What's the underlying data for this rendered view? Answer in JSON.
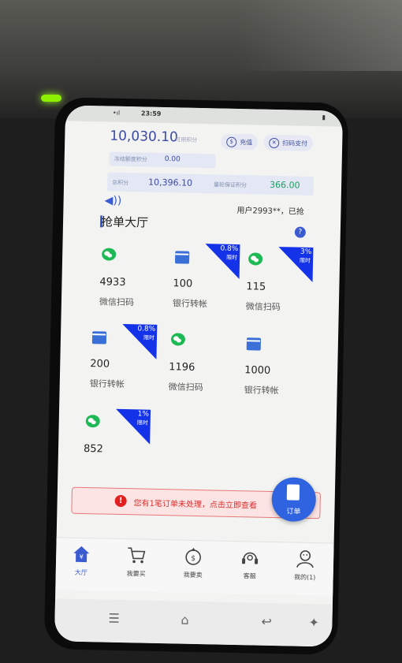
{
  "status": {
    "time": "23:59",
    "signal": "•ıl",
    "battery": "▮"
  },
  "balance": {
    "value": "10,030.10",
    "label": "可用积分"
  },
  "buttons": {
    "recharge": "充值",
    "scan_pay": "扫码支付"
  },
  "frozen": {
    "label": "冻结额度积分",
    "value": "0.00"
  },
  "total": {
    "label": "总积分",
    "value": "10,396.10",
    "deposit_label": "量轮保证积分",
    "deposit_value": "366.00"
  },
  "notice": "用户2993**，已抢",
  "hall_title": "抢单大厅",
  "orders": [
    {
      "amount": "4933",
      "method": "微信扫码",
      "type": "wechat",
      "badge_pct": "",
      "badge_label": ""
    },
    {
      "amount": "100",
      "method": "银行转帐",
      "type": "bank",
      "badge_pct": "0.8%",
      "badge_label": "限时"
    },
    {
      "amount": "115",
      "method": "微信扫码",
      "type": "wechat",
      "badge_pct": "3%",
      "badge_label": "限时"
    },
    {
      "amount": "200",
      "method": "银行转帐",
      "type": "bank",
      "badge_pct": "0.8%",
      "badge_label": "限时"
    },
    {
      "amount": "1196",
      "method": "微信扫码",
      "type": "wechat",
      "badge_pct": "",
      "badge_label": ""
    },
    {
      "amount": "1000",
      "method": "银行转帐",
      "type": "bank",
      "badge_pct": "",
      "badge_label": ""
    },
    {
      "amount": "852",
      "method": "",
      "type": "wechat",
      "badge_pct": "1%",
      "badge_label": "限时"
    }
  ],
  "alert": {
    "text": "您有1笔订单未处理，点击立即查看"
  },
  "float_button": "订单",
  "tabs": [
    {
      "label": "大厅",
      "icon": "home-icon"
    },
    {
      "label": "我要买",
      "icon": "cart-icon"
    },
    {
      "label": "我要卖",
      "icon": "sell-icon"
    },
    {
      "label": "客服",
      "icon": "headset-icon"
    },
    {
      "label": "我的(1)",
      "icon": "profile-icon"
    }
  ],
  "colors": {
    "accent": "#3b5bd0",
    "badge": "#1432e8",
    "alert": "#d83030",
    "wechat": "#1db954"
  }
}
